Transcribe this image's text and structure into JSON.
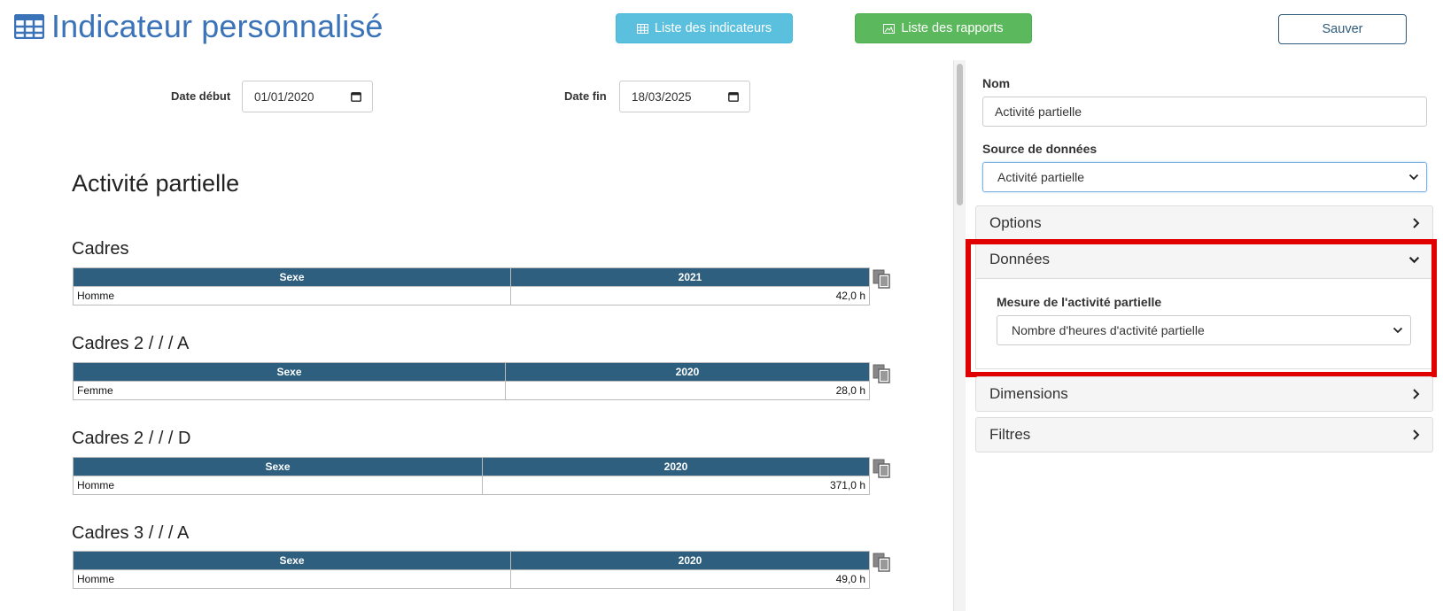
{
  "header": {
    "title": "Indicateur personnalisé",
    "title_icon": "table-icon",
    "btn_indicators": "Liste des indicateurs",
    "btn_reports": "Liste des rapports",
    "btn_save": "Sauver"
  },
  "filters": {
    "start_label": "Date début",
    "start_value": "01/01/2020",
    "end_label": "Date fin",
    "end_value": "18/03/2025"
  },
  "report": {
    "title": "Activité partielle",
    "sections": [
      {
        "title": "Cadres",
        "col1": "Sexe",
        "col2": "2021",
        "row_label": "Homme",
        "row_value": "42,0 h"
      },
      {
        "title": "Cadres 2 / / / A",
        "col1": "Sexe",
        "col2": "2020",
        "row_label": "Femme",
        "row_value": "28,0 h"
      },
      {
        "title": "Cadres 2 / / / D",
        "col1": "Sexe",
        "col2": "2020",
        "row_label": "Homme",
        "row_value": "371,0 h"
      },
      {
        "title": "Cadres 3 / / / A",
        "col1": "Sexe",
        "col2": "2020",
        "row_label": "Homme",
        "row_value": "49,0 h"
      }
    ]
  },
  "sidebar": {
    "name_label": "Nom",
    "name_value": "Activité partielle",
    "source_label": "Source de données",
    "source_value": "Activité partielle",
    "panels": {
      "options": "Options",
      "donnees": "Données",
      "dimensions": "Dimensions",
      "filtres": "Filtres"
    },
    "measure_label": "Mesure de l'activité partielle",
    "measure_value": "Nombre d'heures d'activité partielle"
  },
  "colors": {
    "title_blue": "#3b73b9",
    "info": "#5bc0de",
    "success": "#5cb85c",
    "table_header": "#2e5f7f",
    "highlight": "#e00000"
  }
}
